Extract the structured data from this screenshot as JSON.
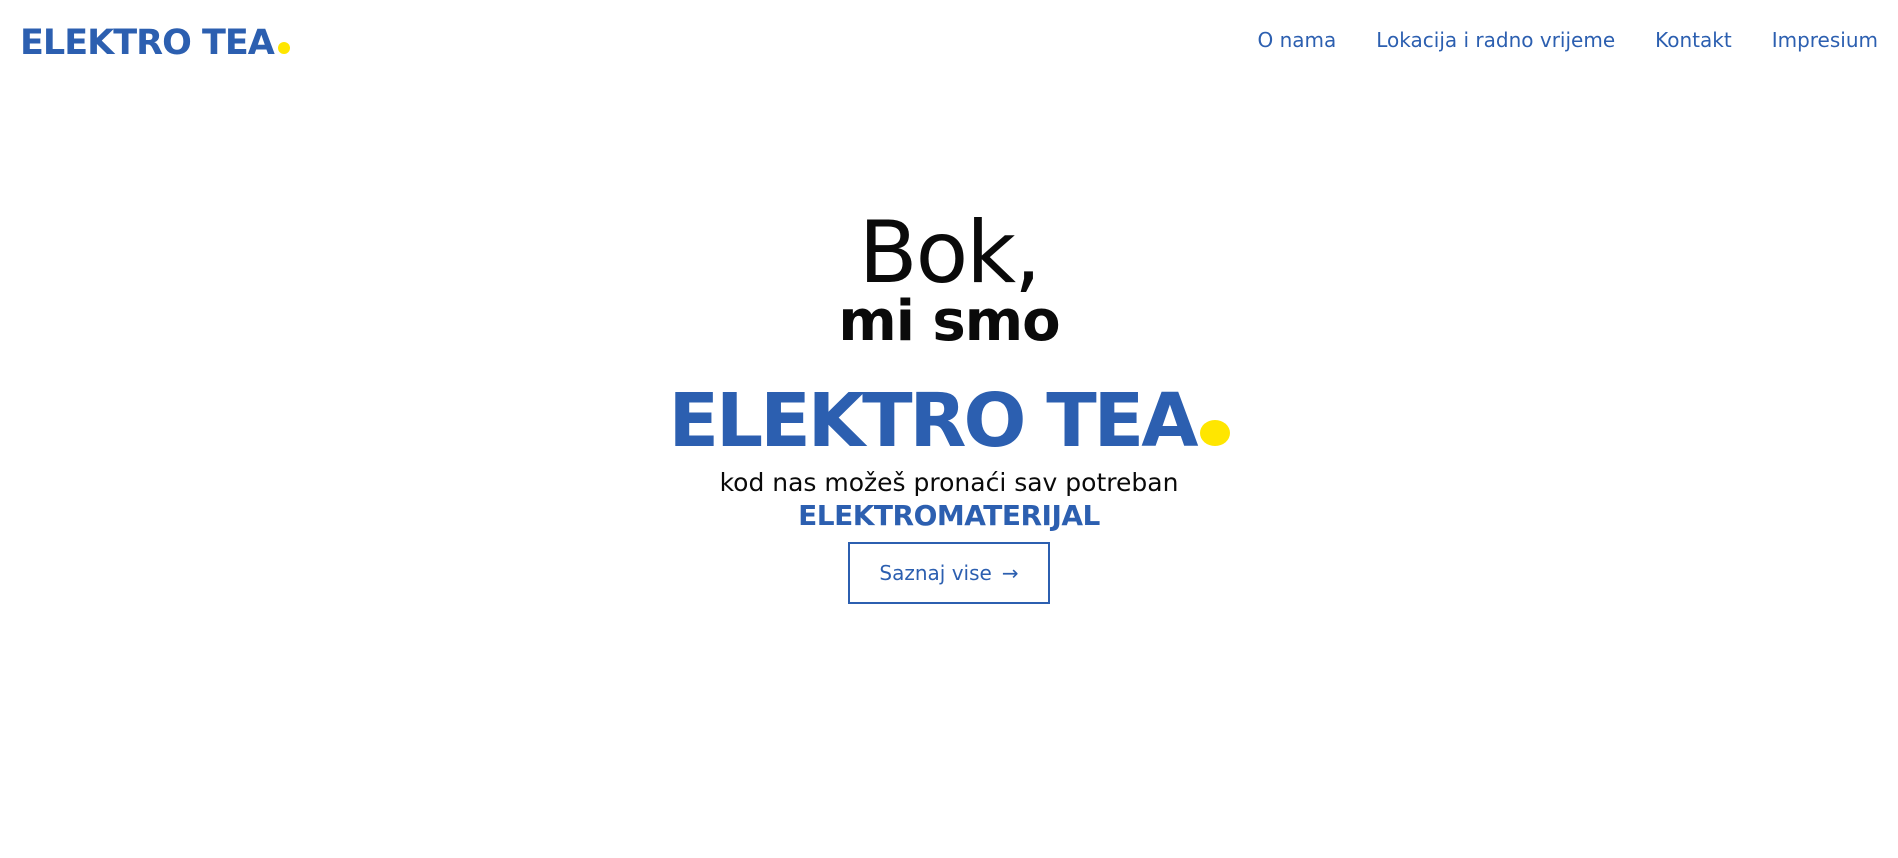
{
  "header": {
    "logo_text": "ELEKTRO TEA",
    "nav": [
      {
        "label": "O nama"
      },
      {
        "label": "Lokacija i radno vrijeme"
      },
      {
        "label": "Kontakt"
      },
      {
        "label": "Impresium"
      }
    ]
  },
  "hero": {
    "greeting": "Bok,",
    "subgreeting": "mi smo",
    "brand": "ELEKTRO TEA",
    "tagline": "kod nas možeš pronaći sav potreban",
    "highlight": "ELEKTROMATERIJAL",
    "cta_label": "Saznaj vise",
    "cta_icon": "arrow-right-icon"
  },
  "colors": {
    "brand_blue": "#2c5fb0",
    "accent_yellow": "#ffe600",
    "text_dark": "#0a0a0a",
    "background": "#ffffff"
  }
}
